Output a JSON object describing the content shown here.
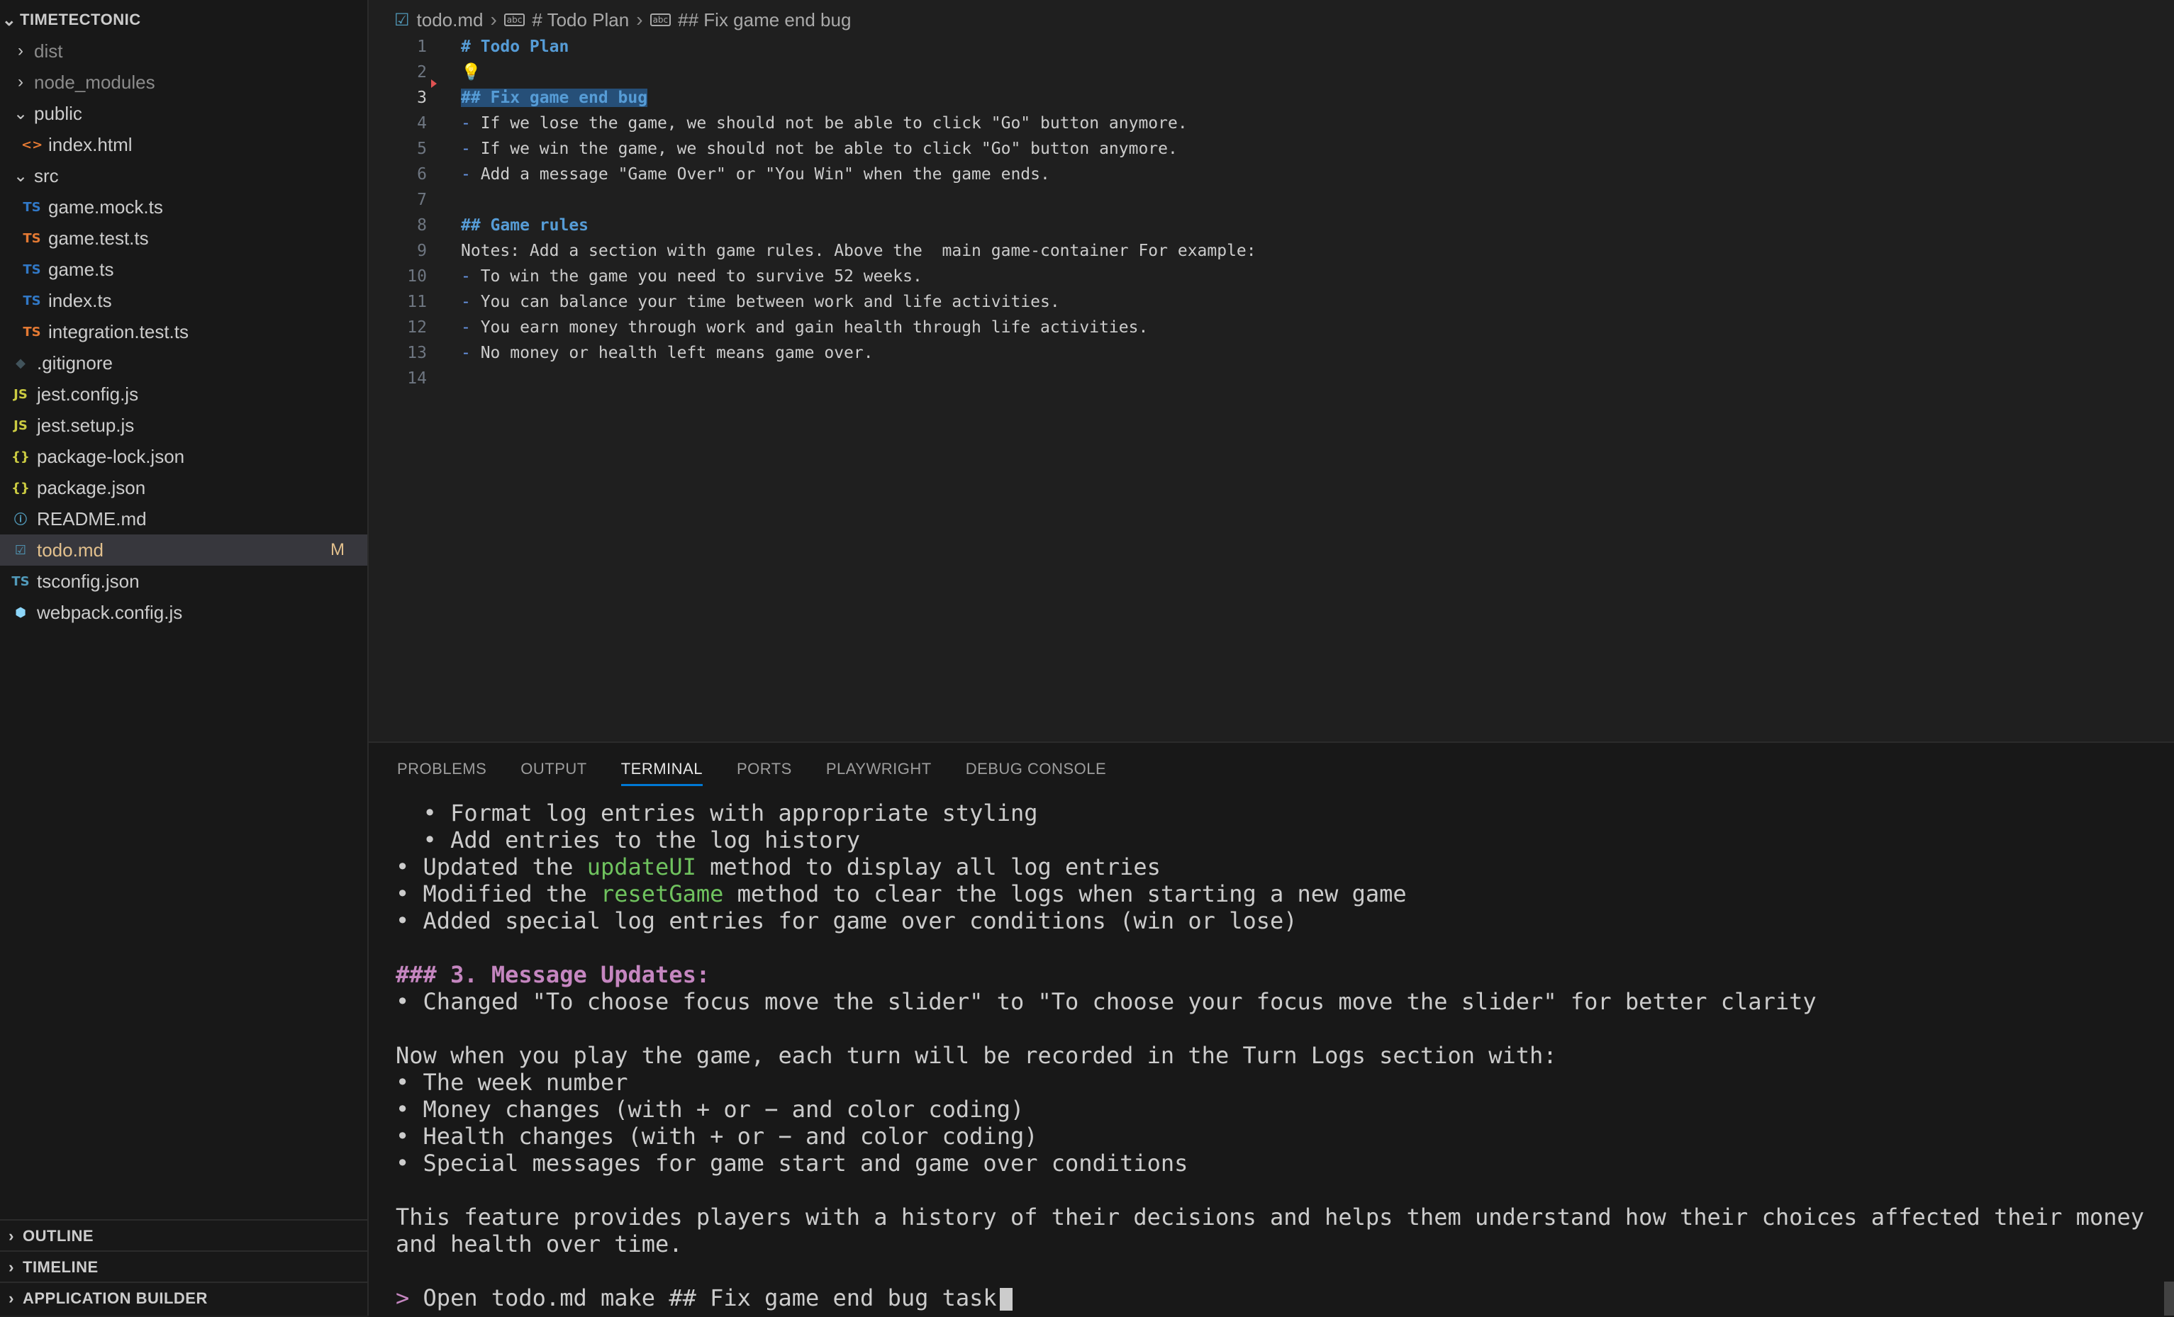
{
  "explorer": {
    "root": "TIMETECTONIC",
    "items": [
      {
        "name": "dist",
        "type": "folder",
        "expanded": false,
        "dim": true
      },
      {
        "name": "node_modules",
        "type": "folder",
        "expanded": false,
        "dim": true
      },
      {
        "name": "public",
        "type": "folder",
        "expanded": true
      },
      {
        "name": "index.html",
        "type": "file",
        "icon": "<>",
        "icon_color": "#e37933",
        "indent": 1
      },
      {
        "name": "src",
        "type": "folder",
        "expanded": true
      },
      {
        "name": "game.mock.ts",
        "type": "file",
        "icon": "TS",
        "icon_color": "#3178c6",
        "indent": 1
      },
      {
        "name": "game.test.ts",
        "type": "file",
        "icon": "TS",
        "icon_color": "#e37933",
        "indent": 1
      },
      {
        "name": "game.ts",
        "type": "file",
        "icon": "TS",
        "icon_color": "#3178c6",
        "indent": 1
      },
      {
        "name": "index.ts",
        "type": "file",
        "icon": "TS",
        "icon_color": "#3178c6",
        "indent": 1
      },
      {
        "name": "integration.test.ts",
        "type": "file",
        "icon": "TS",
        "icon_color": "#e37933",
        "indent": 1
      },
      {
        "name": ".gitignore",
        "type": "file",
        "icon": "◆",
        "icon_color": "#41535b"
      },
      {
        "name": "jest.config.js",
        "type": "file",
        "icon": "JS",
        "icon_color": "#cbcb41"
      },
      {
        "name": "jest.setup.js",
        "type": "file",
        "icon": "JS",
        "icon_color": "#cbcb41"
      },
      {
        "name": "package-lock.json",
        "type": "file",
        "icon": "{}",
        "icon_color": "#cbcb41"
      },
      {
        "name": "package.json",
        "type": "file",
        "icon": "{}",
        "icon_color": "#cbcb41"
      },
      {
        "name": "README.md",
        "type": "file",
        "icon": "ⓘ",
        "icon_color": "#519aba"
      },
      {
        "name": "todo.md",
        "type": "file",
        "icon": "☑",
        "icon_color": "#519aba",
        "selected": true,
        "badge": "M"
      },
      {
        "name": "tsconfig.json",
        "type": "file",
        "icon": "TS",
        "icon_color": "#519aba"
      },
      {
        "name": "webpack.config.js",
        "type": "file",
        "icon": "⬢",
        "icon_color": "#8dd6f9"
      }
    ],
    "sections": [
      "OUTLINE",
      "TIMELINE",
      "APPLICATION BUILDER"
    ]
  },
  "breadcrumb": [
    "todo.md",
    "# Todo Plan",
    "## Fix game end bug"
  ],
  "editor_lines": [
    {
      "n": 1,
      "kind": "heading",
      "text": "# Todo Plan"
    },
    {
      "n": 2,
      "kind": "bulb",
      "text": "💡"
    },
    {
      "n": 3,
      "kind": "heading",
      "text": "## Fix game end bug",
      "active": true,
      "highlight": true
    },
    {
      "n": 4,
      "kind": "bullet",
      "text": "If we lose the game, we should not be able to click \"Go\" button anymore."
    },
    {
      "n": 5,
      "kind": "bullet",
      "text": "If we win the game, we should not be able to click \"Go\" button anymore."
    },
    {
      "n": 6,
      "kind": "bullet",
      "text": "Add a message \"Game Over\" or \"You Win\" when the game ends."
    },
    {
      "n": 7,
      "kind": "plain",
      "text": ""
    },
    {
      "n": 8,
      "kind": "heading",
      "text": "## Game rules"
    },
    {
      "n": 9,
      "kind": "plain",
      "text": "Notes: Add a section with game rules. Above the  main game-container For example:"
    },
    {
      "n": 10,
      "kind": "bullet",
      "text": "To win the game you need to survive 52 weeks."
    },
    {
      "n": 11,
      "kind": "bullet",
      "text": "You can balance your time between work and life activities."
    },
    {
      "n": 12,
      "kind": "bullet",
      "text": "You earn money through work and gain health through life activities."
    },
    {
      "n": 13,
      "kind": "bullet",
      "text": "No money or health left means game over."
    },
    {
      "n": 14,
      "kind": "plain",
      "text": ""
    }
  ],
  "panel_tabs": [
    {
      "label": "PROBLEMS"
    },
    {
      "label": "OUTPUT"
    },
    {
      "label": "TERMINAL",
      "active": true
    },
    {
      "label": "PORTS"
    },
    {
      "label": "PLAYWRIGHT"
    },
    {
      "label": "DEBUG CONSOLE"
    }
  ],
  "terminal_lines": [
    [
      {
        "t": "  • Format log entries with appropriate styling"
      }
    ],
    [
      {
        "t": "  • Add entries to the log history"
      }
    ],
    [
      {
        "t": "• Updated the "
      },
      {
        "t": "updateUI",
        "c": "t-green"
      },
      {
        "t": " method to display all log entries"
      }
    ],
    [
      {
        "t": "• Modified the "
      },
      {
        "t": "resetGame",
        "c": "t-green"
      },
      {
        "t": " method to clear the logs when starting a new game"
      }
    ],
    [
      {
        "t": "• Added special log entries for game over conditions (win or lose)"
      }
    ],
    [
      {
        "t": ""
      }
    ],
    [
      {
        "t": "### 3. Message Updates:",
        "c": "t-head"
      }
    ],
    [
      {
        "t": "• Changed \"To choose focus move the slider\" to \"To choose your focus move the slider\" for better clarity"
      }
    ],
    [
      {
        "t": ""
      }
    ],
    [
      {
        "t": "Now when you play the game, each turn will be recorded in the Turn Logs section with:"
      }
    ],
    [
      {
        "t": "• The week number"
      }
    ],
    [
      {
        "t": "• Money changes (with + or − and color coding)"
      }
    ],
    [
      {
        "t": "• Health changes (with + or − and color coding)"
      }
    ],
    [
      {
        "t": "• Special messages for game start and game over conditions"
      }
    ],
    [
      {
        "t": ""
      }
    ],
    [
      {
        "t": "This feature provides players with a history of their decisions and helps them understand how their choices affected their money"
      }
    ],
    [
      {
        "t": "and health over time."
      }
    ],
    [
      {
        "t": ""
      }
    ]
  ],
  "terminal_prompt": {
    "symbol": ">",
    "input": "Open todo.md make ## Fix game end bug task"
  }
}
